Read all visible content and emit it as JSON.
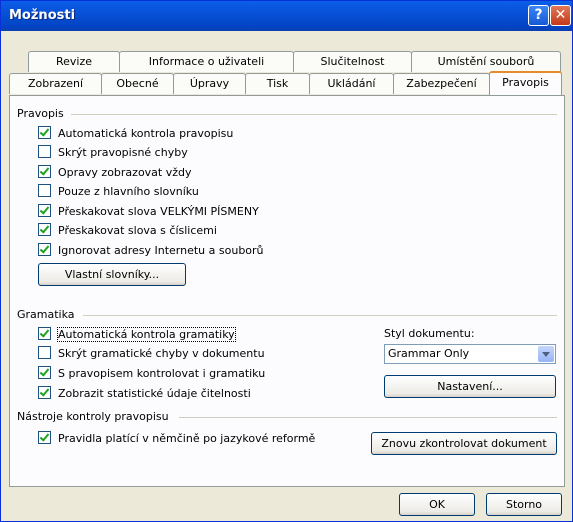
{
  "window": {
    "title": "Možnosti",
    "help_glyph": "?",
    "close_glyph": "✕"
  },
  "tabs_row1": [
    "Revize",
    "Informace o uživateli",
    "Slučitelnost",
    "Umístění souborů"
  ],
  "tabs_row2": [
    "Zobrazení",
    "Obecné",
    "Úpravy",
    "Tisk",
    "Ukládání",
    "Zabezpečení",
    "Pravopis"
  ],
  "active_tab": "Pravopis",
  "spelling": {
    "title": "Pravopis",
    "options": [
      {
        "label": "Automatická kontrola pravopisu",
        "checked": true
      },
      {
        "label": "Skrýt pravopisné chyby",
        "checked": false
      },
      {
        "label": "Opravy zobrazovat vždy",
        "checked": true
      },
      {
        "label": "Pouze z hlavního slovníku",
        "checked": false
      },
      {
        "label": "Přeskakovat slova VELKÝMI PÍSMENY",
        "checked": true
      },
      {
        "label": "Přeskakovat slova s číslicemi",
        "checked": true
      },
      {
        "label": "Ignorovat adresy Internetu a souborů",
        "checked": true
      }
    ],
    "custom_dictionaries_button": "Vlastní slovníky..."
  },
  "grammar": {
    "title": "Gramatika",
    "options": [
      {
        "label": "Automatická kontrola gramatiky",
        "checked": true
      },
      {
        "label": "Skrýt gramatické chyby v dokumentu",
        "checked": false
      },
      {
        "label": "S pravopisem kontrolovat i gramatiku",
        "checked": true
      },
      {
        "label": "Zobrazit statistické údaje čitelnosti",
        "checked": true
      }
    ],
    "style_label": "Styl dokumentu:",
    "style_value": "Grammar Only",
    "settings_button": "Nastavení..."
  },
  "tools": {
    "title": "Nástroje kontroly pravopisu",
    "option": {
      "label": "Pravidla platící v němčině po jazykové reformě",
      "checked": true
    },
    "recheck_button": "Znovu zkontrolovat dokument"
  },
  "footer": {
    "ok": "OK",
    "cancel": "Storno"
  }
}
